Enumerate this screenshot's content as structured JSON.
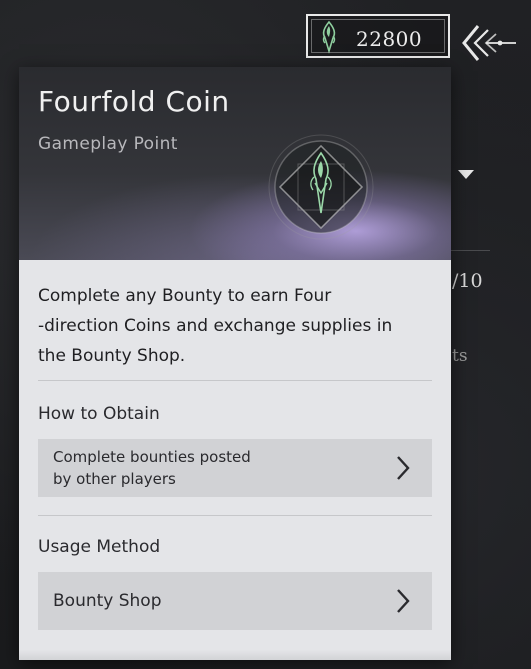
{
  "currency": {
    "value": "22800",
    "icon": "leaf-gem-icon"
  },
  "nav": {
    "back_icon": "back-arrow-icon"
  },
  "item": {
    "title": "Fourfold Coin",
    "subtitle": "Gameplay Point",
    "emblem_icon": "fourfold-coin-emblem-icon",
    "description": "Complete any Bounty to earn Four\n-direction Coins and exchange supplies in\nthe Bounty Shop."
  },
  "obtain": {
    "label": "How to Obtain",
    "entry": "Complete bounties posted\nby other players"
  },
  "usage": {
    "label": "Usage Method",
    "entry": "Bounty Shop"
  },
  "background": {
    "stock_fragment": "/10",
    "desc_fragment": "ts"
  },
  "colors": {
    "accent_green": "#8fcf9f",
    "panel": "#e4e5e8",
    "row": "#d1d2d5"
  }
}
